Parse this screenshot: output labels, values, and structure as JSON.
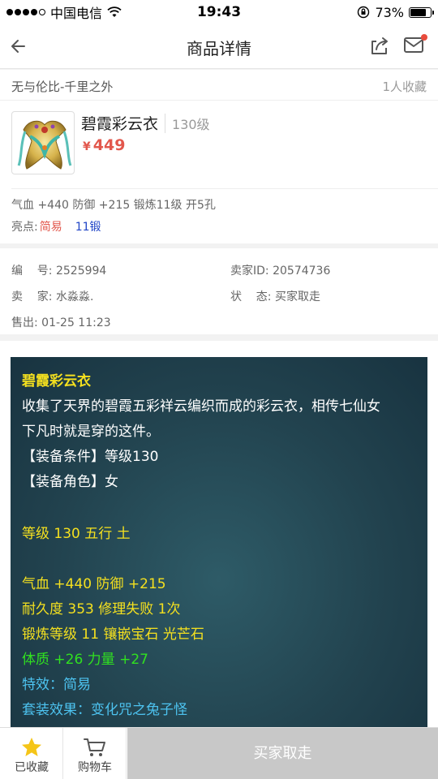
{
  "status_bar": {
    "carrier": "中国电信",
    "time": "19:43",
    "battery": "73%"
  },
  "nav": {
    "title": "商品详情"
  },
  "server": {
    "name": "无与伦比-千里之外",
    "favorites": "1人收藏"
  },
  "item": {
    "name": "碧霞彩云衣",
    "level": "130级",
    "currency_symbol": "¥",
    "price": "449",
    "stats": "气血 +440 防御 +215 锻炼11级 开5孔",
    "highlights_label": "亮点:",
    "highlight_1": "简易",
    "highlight_2": "11锻"
  },
  "info": {
    "serial_label": "编    号:",
    "serial": "2525994",
    "seller_id_label": "卖家ID:",
    "seller_id": "20574736",
    "seller_label": "卖    家:",
    "seller": "水淼淼.",
    "status_label": "状    态:",
    "status": "买家取走",
    "sold_label": "售出:",
    "sold_time": "01-25 11:23"
  },
  "description": {
    "title": "碧霞彩云衣",
    "intro_1": "收集了天界的碧霞五彩祥云编织而成的彩云衣，相传七仙女",
    "intro_2": "下凡时就是穿的这件。",
    "req_level": "【装备条件】等级130",
    "req_role": "【装备角色】女",
    "level_element": "等级 130  五行 土",
    "hp_def": "气血 +440 防御 +215",
    "durability": "耐久度 353  修理失败 1次",
    "forge": "锻炼等级 11  镶嵌宝石 光芒石",
    "attrs": "体质 +26 力量 +27",
    "special": "特效：简易",
    "set_effect": "套装效果：变化咒之兔子怪"
  },
  "bottom": {
    "favorited_label": "已收藏",
    "cart_label": "购物车",
    "buy_label": "买家取走"
  },
  "colors": {
    "price": "#e2574c",
    "highlight_red": "#e2574c",
    "highlight_blue": "#2146c7",
    "desc_yellow": "#f4e01f",
    "desc_green": "#30e020",
    "desc_blue": "#4dc3f0",
    "favorite_star": "#f5c518"
  },
  "icons": {
    "back": "arrow-left-icon",
    "share": "share-icon",
    "mail": "mail-icon",
    "favorite": "star-icon",
    "cart": "cart-icon"
  }
}
